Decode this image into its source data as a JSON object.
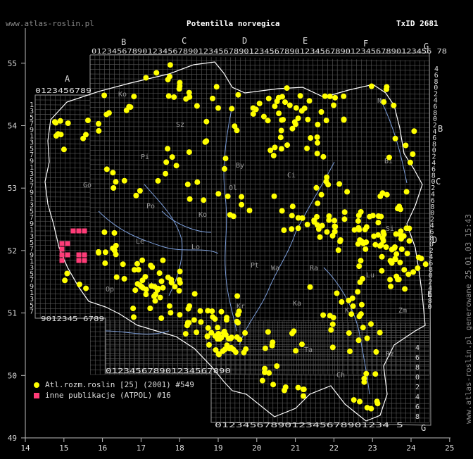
{
  "header": {
    "site": "www.atlas-roslin.pl",
    "title": "Potentilla norvegica",
    "taxid": "TxID 2681"
  },
  "side_note": "www.atlas-roslin.pl generowane 25.01.03 15:43",
  "axes": {
    "lon_ticks": [
      "14",
      "15",
      "16",
      "17",
      "18",
      "19",
      "20",
      "21",
      "22",
      "23",
      "24",
      "25"
    ],
    "lat_ticks": [
      "49",
      "50",
      "51",
      "52",
      "53",
      "54",
      "55"
    ]
  },
  "grid_letters": {
    "top": [
      "A",
      "B",
      "C",
      "D",
      "E",
      "F",
      "G"
    ],
    "right": [
      "B",
      "C",
      "D",
      "E",
      "G"
    ]
  },
  "grid_digit_rows": {
    "top_a": "0123456789",
    "top_main": "0123456789012345678901234567890123456789012345678901234567890123456 78",
    "bottom_a": "9012345 6789",
    "bottom_mid": "012345678901234567890",
    "bottom_low": "0123456789012345678901234 5"
  },
  "region_labels": [
    "Ko",
    "Sz",
    "Pi",
    "By",
    "Ol",
    "Ci",
    "Go",
    "Po",
    "Bi",
    "Ko",
    "Le",
    "Lo",
    "Wa",
    "Si",
    "Pt",
    "Ra",
    "Lu",
    "Wr",
    "Op",
    "Ka",
    "Ki",
    "Kr",
    "Ta",
    "Rz",
    "Ch",
    "Zm",
    "Nw"
  ],
  "legend": [
    {
      "label": "Atl.rozm.roslin [25] (2001) #549",
      "color": "#ffff00",
      "shape": "dot"
    },
    {
      "label": "inne publikacje (ATPOL) #16",
      "color": "#ff3c78",
      "shape": "square"
    }
  ],
  "colors": {
    "background": "#000000",
    "grid": "#5a5a5a",
    "dot": "#ffff00",
    "square": "#ff3c78",
    "river": "#7a9cd8",
    "border": "#ffffff"
  }
}
